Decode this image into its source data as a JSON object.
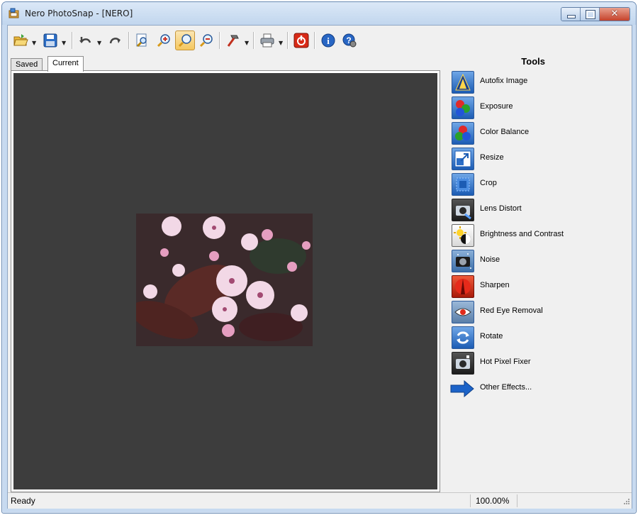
{
  "window": {
    "title": "Nero PhotoSnap - [NERO]"
  },
  "colors": {
    "canvas_bg": "#3d3d3d",
    "tool_icon_blue": "#1c5cb4",
    "close_red": "#c5422b"
  },
  "toolbar": {
    "buttons": [
      {
        "name": "open",
        "icon": "folder-open-icon"
      },
      {
        "name": "save",
        "icon": "save-icon"
      },
      {
        "name": "undo",
        "icon": "undo-icon"
      },
      {
        "name": "redo",
        "icon": "redo-icon"
      },
      {
        "name": "zoom-fit",
        "icon": "zoom-page-icon"
      },
      {
        "name": "zoom-in",
        "icon": "zoom-in-icon"
      },
      {
        "name": "zoom-actual",
        "icon": "zoom-actual-icon"
      },
      {
        "name": "zoom-out",
        "icon": "zoom-out-icon"
      },
      {
        "name": "tools",
        "icon": "hammer-icon"
      },
      {
        "name": "print",
        "icon": "printer-icon"
      },
      {
        "name": "exit",
        "icon": "power-icon"
      },
      {
        "name": "info",
        "icon": "info-icon"
      },
      {
        "name": "help",
        "icon": "help-icon"
      }
    ]
  },
  "tabs": [
    {
      "label": "Saved",
      "selected": false
    },
    {
      "label": "Current",
      "selected": true
    }
  ],
  "tools": {
    "title": "Tools",
    "items": [
      {
        "label": "Autofix Image",
        "icon": "autofix-icon"
      },
      {
        "label": "Exposure",
        "icon": "exposure-icon"
      },
      {
        "label": "Color Balance",
        "icon": "color-balance-icon"
      },
      {
        "label": "Resize",
        "icon": "resize-icon"
      },
      {
        "label": "Crop",
        "icon": "crop-icon"
      },
      {
        "label": "Lens Distort",
        "icon": "lens-distort-icon"
      },
      {
        "label": "Brightness and Contrast",
        "icon": "brightness-contrast-icon"
      },
      {
        "label": "Noise",
        "icon": "noise-icon"
      },
      {
        "label": "Sharpen",
        "icon": "sharpen-icon"
      },
      {
        "label": "Red Eye Removal",
        "icon": "red-eye-icon"
      },
      {
        "label": "Rotate",
        "icon": "rotate-icon"
      },
      {
        "label": "Hot Pixel Fixer",
        "icon": "hot-pixel-icon"
      },
      {
        "label": "Other Effects...",
        "icon": "arrow-right-icon"
      }
    ]
  },
  "status": {
    "text": "Ready",
    "zoom": "100.00%"
  }
}
